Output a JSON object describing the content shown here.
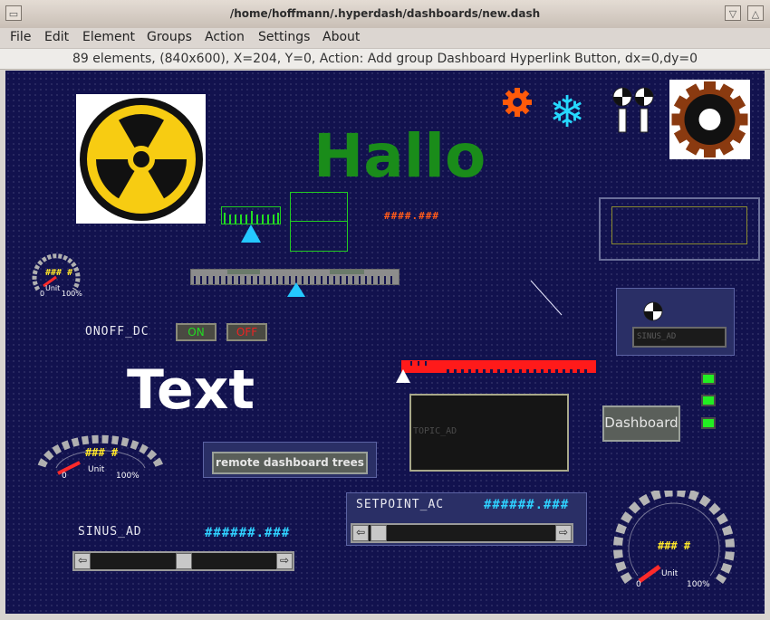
{
  "window": {
    "title": "/home/hoffmann/.hyperdash/dashboards/new.dash"
  },
  "menu": {
    "items": [
      "File",
      "Edit",
      "Element",
      "Groups",
      "Action",
      "Settings",
      "About"
    ]
  },
  "status": {
    "text": "89 elements, (840x600), X=204, Y=0, Action: Add group Dashboard Hyperlink Button, dx=0,dy=0"
  },
  "canvas": {
    "hallo_text": "Hallo",
    "big_text": "Text",
    "orange_hash": "####.###",
    "onoff_label": "ONOFF_DC",
    "on_button": "ON",
    "off_button": "OFF",
    "remote_button": "remote dashboard trees",
    "topic_label": "TOPIC_AD",
    "dashboard_button": "Dashboard",
    "sinus_label_panel": "SINUS_AD",
    "setpoint_label": "SETPOINT_AC",
    "setpoint_value": "######.###",
    "sinus_label": "SINUS_AD",
    "sinus_value": "######.###",
    "gauge_small": {
      "value": "### #",
      "unit": "Unit",
      "min": "0",
      "max": "100%"
    },
    "gauge_medium": {
      "value": "### #",
      "unit": "Unit",
      "min": "0",
      "max": "100%"
    },
    "gauge_large": {
      "value": "### #",
      "unit": "Unit",
      "min": "0",
      "max": "100%"
    }
  },
  "icons": [
    "radiation-icon",
    "gear-icon",
    "snowflake-icon",
    "checkered-flag-icon",
    "cogwheel-icon",
    "checkered-icon"
  ],
  "colors": {
    "background": "#12124e",
    "hallo": "#1a8c1a",
    "led": "#22ee22",
    "ticker": "#ff1a1a",
    "hash": "#2fd0ff"
  }
}
